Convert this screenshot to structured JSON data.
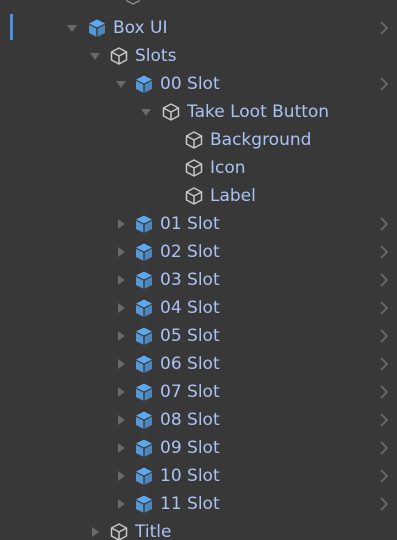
{
  "hierarchy": {
    "rows": [
      {
        "label": "Box UI",
        "prefab": true,
        "arrow": "expanded",
        "chevron": true
      },
      {
        "label": "Slots",
        "prefab": false,
        "arrow": "expanded",
        "chevron": false
      },
      {
        "label": "00 Slot",
        "prefab": true,
        "arrow": "expanded",
        "chevron": true
      },
      {
        "label": "Take Loot Button",
        "prefab": false,
        "arrow": "expanded",
        "chevron": false
      },
      {
        "label": "Background",
        "prefab": false,
        "arrow": "none",
        "chevron": false
      },
      {
        "label": "Icon",
        "prefab": false,
        "arrow": "none",
        "chevron": false
      },
      {
        "label": "Label",
        "prefab": false,
        "arrow": "none",
        "chevron": false
      },
      {
        "label": "01 Slot",
        "prefab": true,
        "arrow": "collapsed",
        "chevron": true
      },
      {
        "label": "02 Slot",
        "prefab": true,
        "arrow": "collapsed",
        "chevron": true
      },
      {
        "label": "03 Slot",
        "prefab": true,
        "arrow": "collapsed",
        "chevron": true
      },
      {
        "label": "04 Slot",
        "prefab": true,
        "arrow": "collapsed",
        "chevron": true
      },
      {
        "label": "05 Slot",
        "prefab": true,
        "arrow": "collapsed",
        "chevron": true
      },
      {
        "label": "06 Slot",
        "prefab": true,
        "arrow": "collapsed",
        "chevron": true
      },
      {
        "label": "07 Slot",
        "prefab": true,
        "arrow": "collapsed",
        "chevron": true
      },
      {
        "label": "08 Slot",
        "prefab": true,
        "arrow": "collapsed",
        "chevron": true
      },
      {
        "label": "09 Slot",
        "prefab": true,
        "arrow": "collapsed",
        "chevron": true
      },
      {
        "label": "10 Slot",
        "prefab": true,
        "arrow": "collapsed",
        "chevron": true
      },
      {
        "label": "11 Slot",
        "prefab": true,
        "arrow": "collapsed",
        "chevron": true
      },
      {
        "label": "Title",
        "prefab": false,
        "arrow": "collapsed",
        "chevron": false
      }
    ]
  },
  "colors": {
    "background": "#383838",
    "text": "#a9c3f5",
    "prefab_icon": "#5aa8f0",
    "outline_icon": "#c8c8c8",
    "arrow": "#6a6a6a",
    "selection_bar": "#4d8fe0"
  }
}
